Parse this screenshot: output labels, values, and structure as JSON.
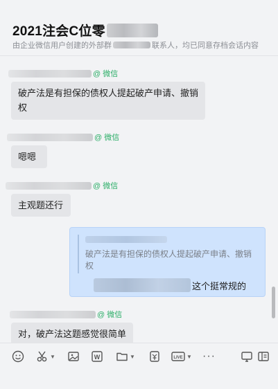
{
  "header": {
    "title": "2021注会C位零",
    "subtitle_prefix": "由企业微信用户创建的外部群",
    "subtitle_suffix": "联系人，均已同意存档会话内容"
  },
  "messages": [
    {
      "source_tag": "@ 微信",
      "text": "破产法是有担保的债权人提起破产申请、撤销权"
    },
    {
      "source_tag": "@ 微信",
      "text": "嗯嗯"
    },
    {
      "source_tag": "@ 微信",
      "text": "主观题还行"
    },
    {
      "quoted_text": "破产法是有担保的债权人提起破产申请、撤销权",
      "reply_text": "这个挺常规的"
    },
    {
      "source_tag": "@ 微信",
      "text": "对，破产法这题感觉很简单"
    }
  ],
  "toolbar": {
    "icons": [
      "emoji-icon",
      "scissors-icon",
      "image-icon",
      "word-file-icon",
      "folder-icon",
      "red-packet-icon",
      "live-icon",
      "more-icon",
      "screen-share-icon",
      "sidebar-icon"
    ],
    "live_label": "LIVE",
    "more_label": "···",
    "word_label": "W"
  },
  "colors": {
    "accent_tag": "#2bae67",
    "my_bubble": "#cfe3fd",
    "other_bubble": "#e4e5e8"
  }
}
